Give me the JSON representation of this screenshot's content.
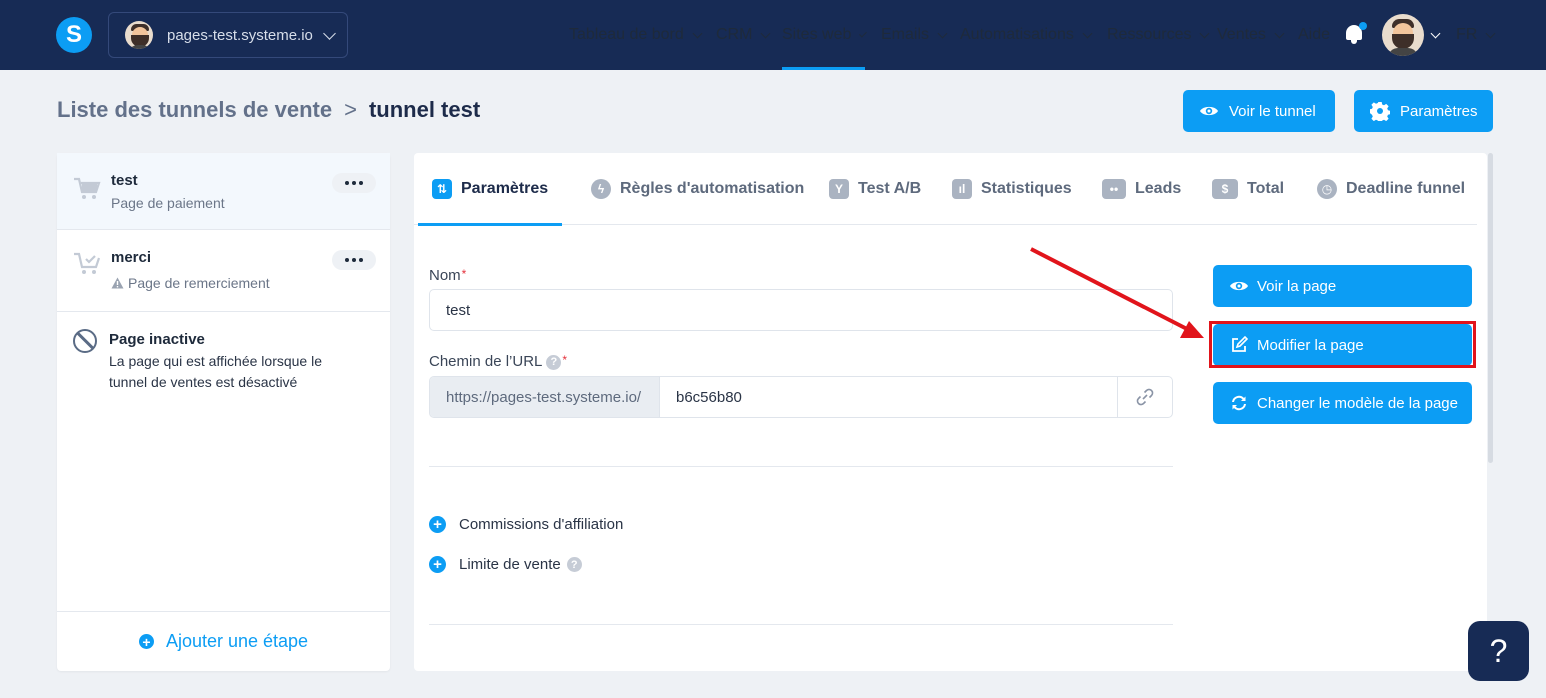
{
  "topbar": {
    "logo_letter": "S",
    "domain": "pages-test.systeme.io",
    "nav": [
      {
        "label": "Tableau de bord",
        "dropdown": true
      },
      {
        "label": "CRM",
        "dropdown": true
      },
      {
        "label": "Sites web",
        "dropdown": true,
        "active": true
      },
      {
        "label": "Emails",
        "dropdown": true
      },
      {
        "label": "Automatisations",
        "dropdown": true
      },
      {
        "label": "Ressources",
        "dropdown": true
      },
      {
        "label": "Ventes",
        "dropdown": true
      },
      {
        "label": "Aide",
        "dropdown": false
      }
    ],
    "language": "FR"
  },
  "breadcrumb": {
    "parent": "Liste des tunnels de vente",
    "separator": ">",
    "current": "tunnel test"
  },
  "header_buttons": {
    "view_funnel": "Voir le tunnel",
    "settings": "Paramètres"
  },
  "steps": [
    {
      "title": "test",
      "subtitle": "Page de paiement",
      "selected": true
    },
    {
      "title": "merci",
      "subtitle": "Page de remerciement",
      "warning": true
    }
  ],
  "inactive_page": {
    "title": "Page inactive",
    "description_line1": "La page qui est affichée lorsque le",
    "description_line2": "tunnel de ventes est désactivé"
  },
  "add_step": "Ajouter une étape",
  "tabs": [
    {
      "label": "Paramètres",
      "icon": "sliders-icon",
      "active": true
    },
    {
      "label": "Règles d'automatisation",
      "icon": "bolt-icon"
    },
    {
      "label": "Test A/B",
      "icon": "split-icon"
    },
    {
      "label": "Statistiques",
      "icon": "bar-chart-icon"
    },
    {
      "label": "Leads",
      "icon": "users-icon"
    },
    {
      "label": "Total",
      "icon": "dollar-icon"
    },
    {
      "label": "Deadline funnel",
      "icon": "clock-icon"
    }
  ],
  "form": {
    "name_label": "Nom",
    "name_value": "test",
    "url_label": "Chemin de l’URL",
    "url_prefix": "https://pages-test.systeme.io/",
    "url_slug": "b6c56b80",
    "required_mark": "*",
    "help_mark": "?",
    "commissions": "Commissions d'affiliation",
    "sales_limit": "Limite de vente"
  },
  "page_actions": {
    "view": "Voir la page",
    "edit": "Modifier la page",
    "change_template": "Changer le modèle de la page"
  },
  "help_fab": "?",
  "colors": {
    "topbar": "#172b55",
    "accent": "#0c9df4",
    "highlight": "#e1141b"
  }
}
